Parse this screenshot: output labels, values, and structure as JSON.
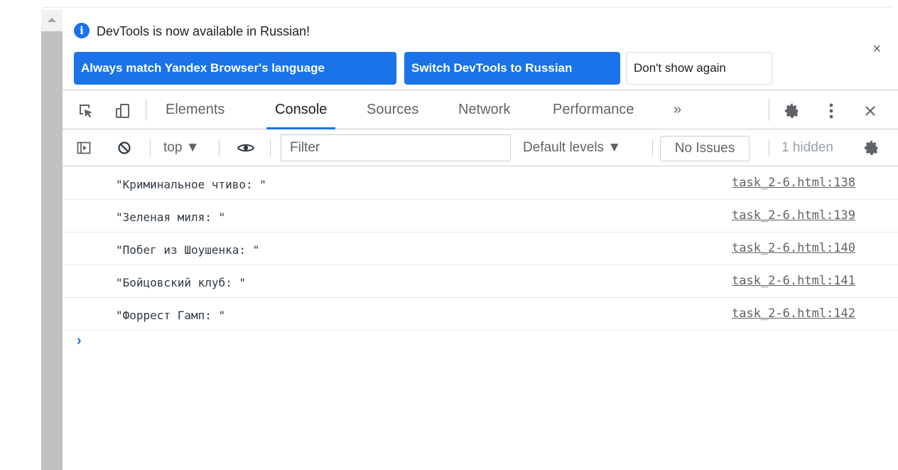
{
  "infobar": {
    "message": "DevTools is now available in Russian!",
    "info_icon": "i",
    "buttons": {
      "always_match": "Always match Yandex Browser's language",
      "switch": "Switch DevTools to Russian",
      "dont_show": "Don't show again"
    },
    "close_glyph": "×"
  },
  "tabs": {
    "elements": "Elements",
    "console": "Console",
    "sources": "Sources",
    "network": "Network",
    "performance": "Performance",
    "more": "»"
  },
  "console_toolbar": {
    "context": "top ▼",
    "filter_placeholder": "Filter",
    "levels": "Default levels ▼",
    "issues": "No Issues",
    "hidden": "1 hidden"
  },
  "messages": [
    {
      "text": "\"Криминальное чтиво: \"",
      "source": "task_2-6.html:138"
    },
    {
      "text": "\"Зеленая миля: \"",
      "source": "task_2-6.html:139"
    },
    {
      "text": "\"Побег из Шоушенка: \"",
      "source": "task_2-6.html:140"
    },
    {
      "text": "\"Бойцовский клуб: \"",
      "source": "task_2-6.html:141"
    },
    {
      "text": "\"Форрест Гамп: \"",
      "source": "task_2-6.html:142"
    }
  ],
  "prompt_glyph": "›",
  "colors": {
    "accent": "#1a73e8",
    "toolbar_border": "#cacdd1",
    "text": "#303942"
  }
}
